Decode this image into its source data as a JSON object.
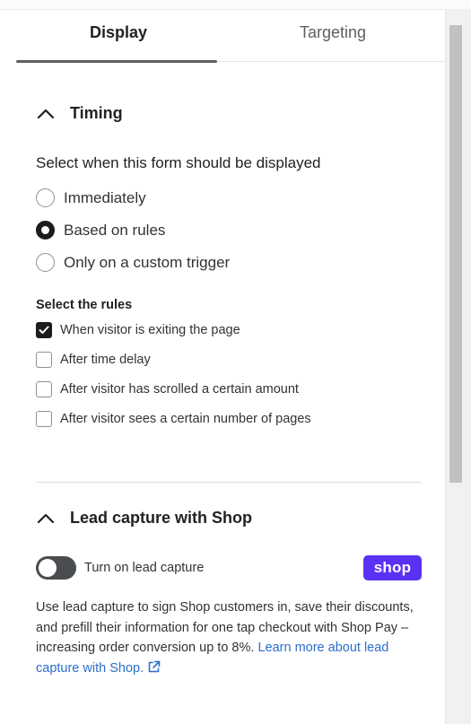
{
  "tabs": [
    {
      "label": "Display",
      "active": true
    },
    {
      "label": "Targeting",
      "active": false
    }
  ],
  "timing": {
    "title": "Timing",
    "description": "Select when this form should be displayed",
    "options": [
      {
        "label": "Immediately",
        "selected": false
      },
      {
        "label": "Based on rules",
        "selected": true
      },
      {
        "label": "Only on a custom trigger",
        "selected": false
      }
    ],
    "rules_title": "Select the rules",
    "rules": [
      {
        "label": "When visitor is exiting the page",
        "checked": true
      },
      {
        "label": "After time delay",
        "checked": false
      },
      {
        "label": "After visitor has scrolled a certain amount",
        "checked": false
      },
      {
        "label": "After visitor sees a certain number of pages",
        "checked": false
      }
    ]
  },
  "lead_capture": {
    "title": "Lead capture with Shop",
    "toggle_label": "Turn on lead capture",
    "toggle_on": false,
    "badge": "shop",
    "description": "Use lead capture to sign Shop customers in, save their discounts, and prefill their information for one tap checkout with Shop Pay – increasing order conversion up to 8%.",
    "link_text": "Learn more about lead capture with Shop."
  },
  "colors": {
    "accent": "#5c5f62",
    "shop_brand": "#5a31f4",
    "link": "#2c6ecb",
    "selected": "#1a1c1d"
  },
  "icons": [
    "chevron-up-icon",
    "checkmark-icon",
    "external-link-icon"
  ]
}
